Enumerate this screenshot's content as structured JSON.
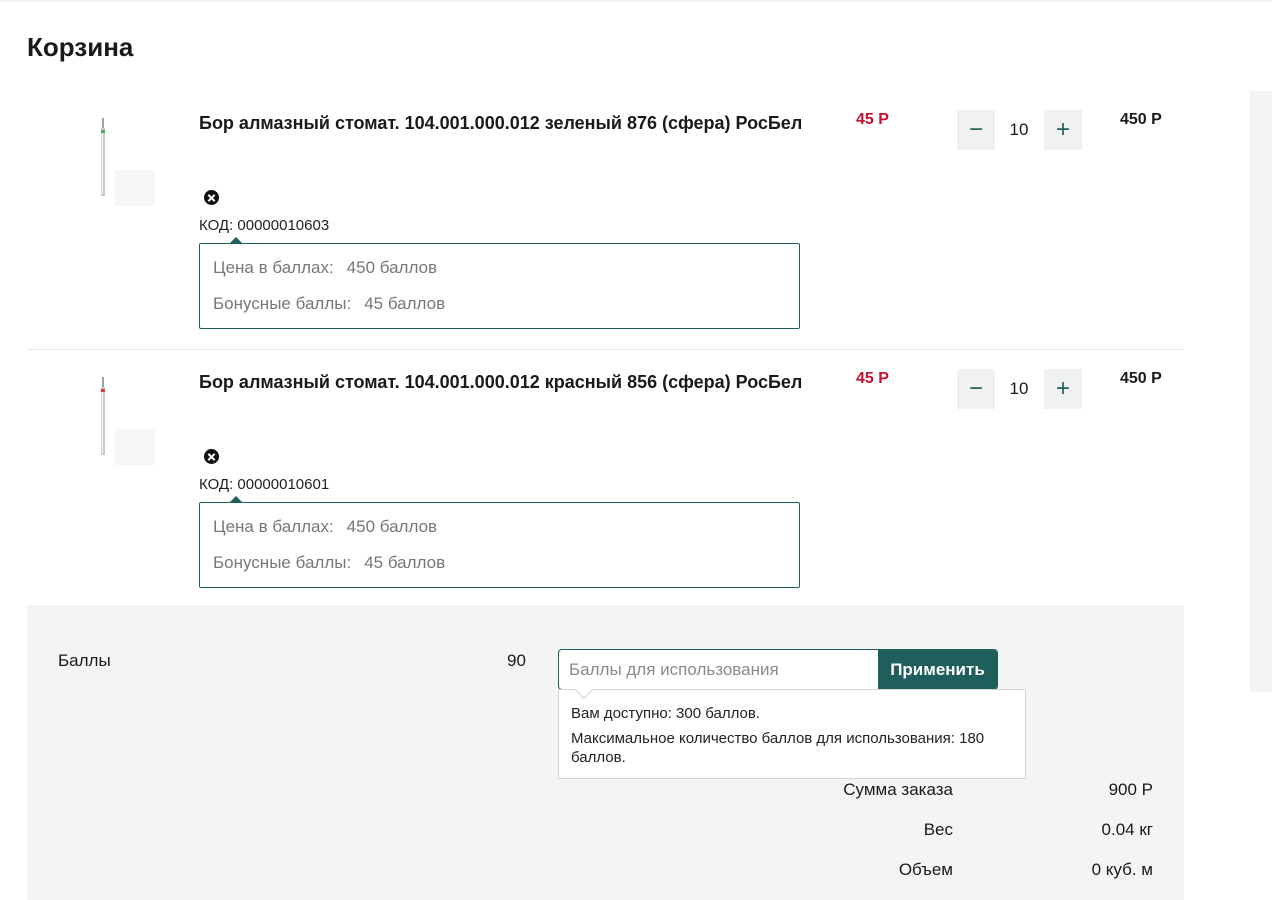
{
  "page": {
    "title": "Корзина"
  },
  "cart": {
    "items": [
      {
        "name": "Бор алмазный стомат. 104.001.000.012 зеленый 876 (сфера) РосБел",
        "code": "КОД: 00000010603",
        "band_color": "#4caf50",
        "bonus": {
          "price_label": "Цена в баллах:",
          "price_value": "450 баллов",
          "bonus_label": "Бонусные баллы:",
          "bonus_value": "45 баллов"
        },
        "unit_price": "45 Р",
        "qty": "10",
        "total": "450 Р"
      },
      {
        "name": "Бор алмазный стомат. 104.001.000.012 красный 856 (сфера) РосБел",
        "code": "КОД: 00000010601",
        "band_color": "#e53935",
        "bonus": {
          "price_label": "Цена в баллах:",
          "price_value": "450 баллов",
          "bonus_label": "Бонусные баллы:",
          "bonus_value": "45 баллов"
        },
        "unit_price": "45 Р",
        "qty": "10",
        "total": "450 Р"
      }
    ],
    "minus_label": "−",
    "plus_label": "+"
  },
  "points": {
    "label": "Баллы",
    "value": "90",
    "input_placeholder": "Баллы для использования",
    "apply_label": "Применить",
    "tooltip_available": "Вам доступно: 300 баллов.",
    "tooltip_max": "Максимальное количество баллов для использования: 180 баллов."
  },
  "summary": {
    "order_sum_label": "Сумма заказа",
    "order_sum_value": "900 Р",
    "weight_label": "Вес",
    "weight_value": "0.04 кг",
    "volume_label": "Объем",
    "volume_value": "0 куб. м"
  },
  "colors": {
    "accent": "#1e5f5b",
    "price": "#c8102e",
    "summary_bg": "#f4f4f4"
  }
}
